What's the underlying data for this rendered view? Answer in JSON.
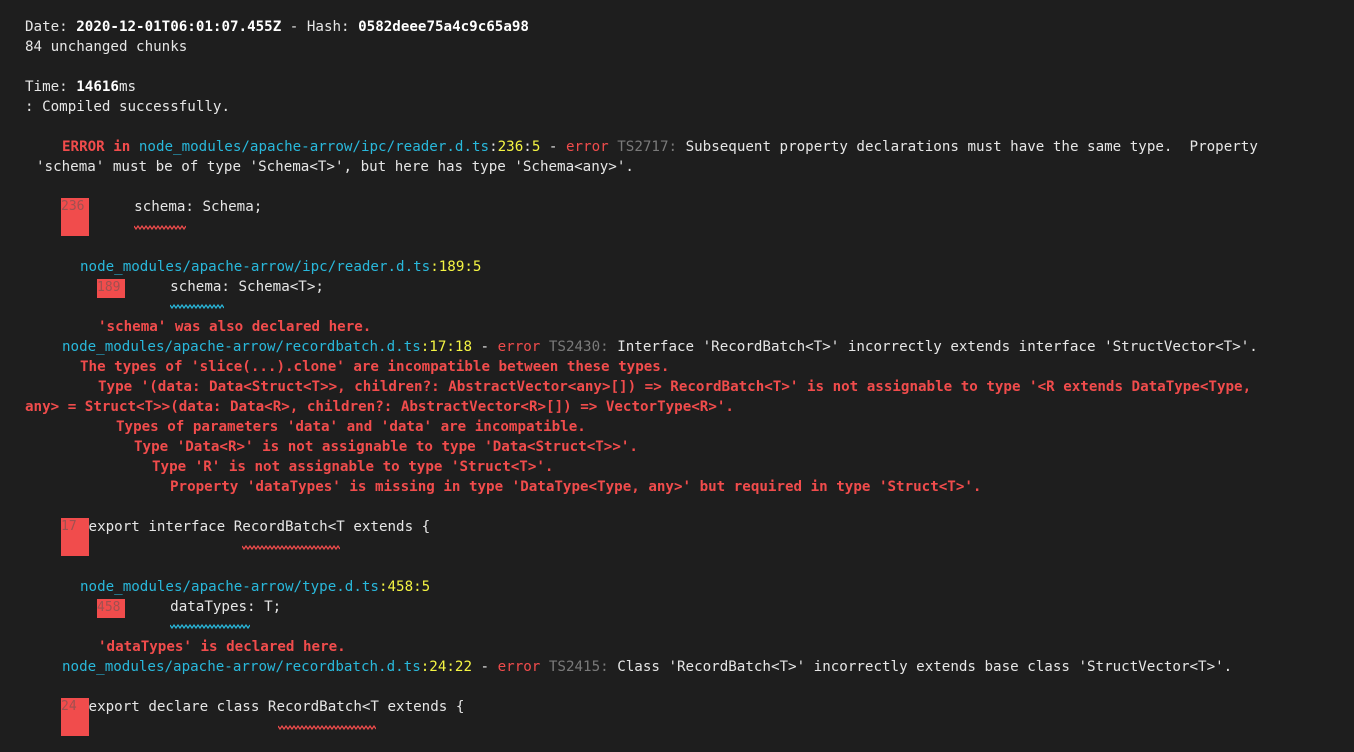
{
  "header": {
    "date_label": "Date: ",
    "date_value": "2020-12-01T06:01:07.455Z",
    "hash_label": " - Hash: ",
    "hash_value": "0582deee75a4c9c65a98",
    "unchanged": "84 unchanged chunks",
    "time_label": "Time: ",
    "time_value": "14616",
    "time_unit": "ms",
    "compiled": ": Compiled successfully."
  },
  "errors": {
    "e1": {
      "prefix": "ERROR in ",
      "file": "node_modules/apache-arrow/ipc/reader.d.ts",
      "sep": ":",
      "line": "236",
      "col_sep": ":",
      "col": "5",
      "dash": " - ",
      "error_word": "error",
      "code": " TS2717:",
      "msg1": " Subsequent property declarations must have the same type.  Property",
      "msg2": "'schema' must be of type 'Schema<T>', but here has type 'Schema<any>'.",
      "gutter": "236",
      "code_line": "    schema: Schema;",
      "related_file": "node_modules/apache-arrow/ipc/reader.d.ts",
      "related_loc": ":189:5",
      "related_gutter": "189",
      "related_code": "    schema: Schema<T>;",
      "related_note": "'schema' was also declared here."
    },
    "e2": {
      "file": "node_modules/apache-arrow/recordbatch.d.ts",
      "loc": ":17:18",
      "dash": " - ",
      "error_word": "error",
      "code": " TS2430:",
      "msg": " Interface 'RecordBatch<T>' incorrectly extends interface 'StructVector<T>'.",
      "detail1": "The types of 'slice(...).clone' are incompatible between these types.",
      "detail2": "Type '(data: Data<Struct<T>>, children?: AbstractVector<any>[]) => RecordBatch<T>' is not assignable to type '<R extends DataType<Type,",
      "detail3": "any> = Struct<T>>(data: Data<R>, children?: AbstractVector<R>[]) => VectorType<R>'.",
      "detail4": "Types of parameters 'data' and 'data' are incompatible.",
      "detail5": "Type 'Data<R>' is not assignable to type 'Data<Struct<T>>'.",
      "detail6": "Type 'R' is not assignable to type 'Struct<T>'.",
      "detail7": "Property 'dataTypes' is missing in type 'DataType<Type, any>' but required in type 'Struct<T>'.",
      "gutter": "17",
      "code_line": " export interface RecordBatch<T extends {",
      "related_file": "node_modules/apache-arrow/type.d.ts",
      "related_loc": ":458:5",
      "related_gutter": "458",
      "related_code": "    dataTypes: T;",
      "related_note": "'dataTypes' is declared here."
    },
    "e3": {
      "file": "node_modules/apache-arrow/recordbatch.d.ts",
      "loc": ":24:22",
      "dash": " - ",
      "error_word": "error",
      "code": " TS2415:",
      "msg": " Class 'RecordBatch<T>' incorrectly extends base class 'StructVector<T>'.",
      "gutter": "24",
      "code_line": " export declare class RecordBatch<T extends {"
    }
  },
  "colors": {
    "background": "#1e1e1e",
    "error_red": "#f14c4c",
    "path_cyan": "#29b8db",
    "location_yellow": "#f5f543"
  }
}
